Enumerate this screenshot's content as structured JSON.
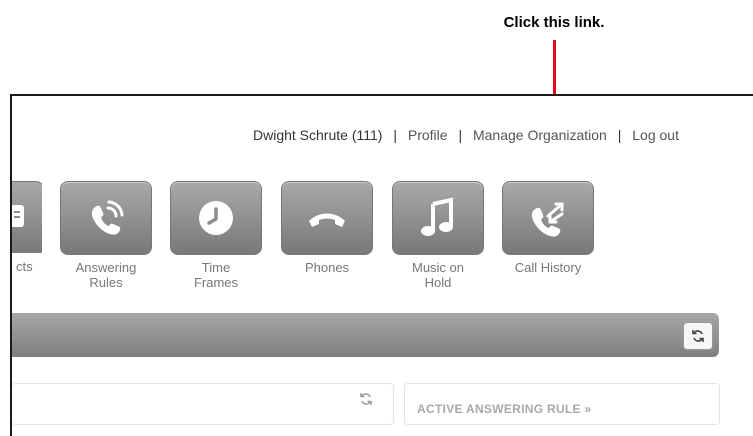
{
  "callout": {
    "text": "Click this link."
  },
  "user_nav": {
    "user": "Dwight Schrute (111)",
    "separator": "|",
    "profile": "Profile",
    "manage_org": "Manage Organization",
    "logout": "Log out"
  },
  "tiles": [
    {
      "label": "cts",
      "icon": "contacts-icon"
    },
    {
      "label_line1": "Answering",
      "label_line2": "Rules",
      "icon": "phone-waves-icon"
    },
    {
      "label_line1": "Time",
      "label_line2": "Frames",
      "icon": "clock-icon"
    },
    {
      "label_line1": "Phones",
      "label_line2": "",
      "icon": "handset-icon"
    },
    {
      "label_line1": "Music on",
      "label_line2": "Hold",
      "icon": "music-note-icon"
    },
    {
      "label_line1": "Call History",
      "label_line2": "",
      "icon": "call-history-icon"
    }
  ],
  "panels": {
    "active_answering_rule": "ACTIVE ANSWERING RULE »"
  },
  "colors": {
    "accent_red": "#e8001c",
    "tile_gray": "#8c8c8c",
    "label_gray": "#777777"
  }
}
